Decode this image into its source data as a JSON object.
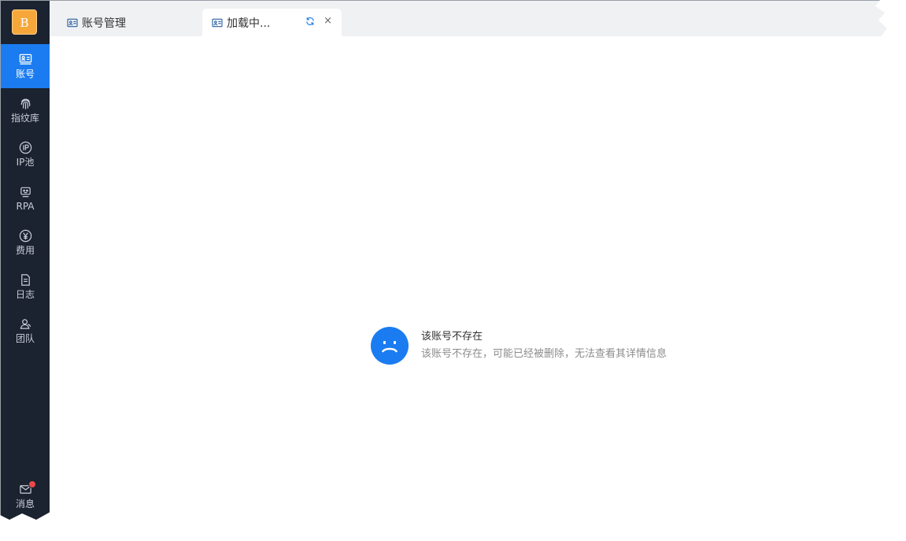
{
  "sidebar": {
    "logo": "B",
    "items": [
      {
        "label": "账号",
        "icon": "id-card-icon",
        "active": true
      },
      {
        "label": "指纹库",
        "icon": "fingerprint-icon",
        "active": false
      },
      {
        "label": "IP池",
        "icon": "ip-icon",
        "active": false
      },
      {
        "label": "RPA",
        "icon": "robot-icon",
        "active": false
      },
      {
        "label": "费用",
        "icon": "yuan-icon",
        "active": false
      },
      {
        "label": "日志",
        "icon": "document-icon",
        "active": false
      },
      {
        "label": "团队",
        "icon": "team-icon",
        "active": false
      }
    ],
    "message": {
      "label": "消息",
      "icon": "mail-icon",
      "has_badge": true
    }
  },
  "tabs": [
    {
      "label": "账号管理",
      "icon": "id-card-icon",
      "active": false
    },
    {
      "label": "加载中...",
      "icon": "id-card-icon",
      "active": true,
      "close": "×",
      "refresh_icon": "refresh-icon"
    }
  ],
  "empty_state": {
    "icon": "sad-face-icon",
    "title": "该账号不存在",
    "description": "该账号不存在，可能已经被删除，无法查看其详情信息"
  },
  "colors": {
    "sidebar_bg": "#1b2230",
    "accent": "#1a7cf0",
    "logo_bg": "#f7a73a",
    "badge": "#f04848"
  }
}
